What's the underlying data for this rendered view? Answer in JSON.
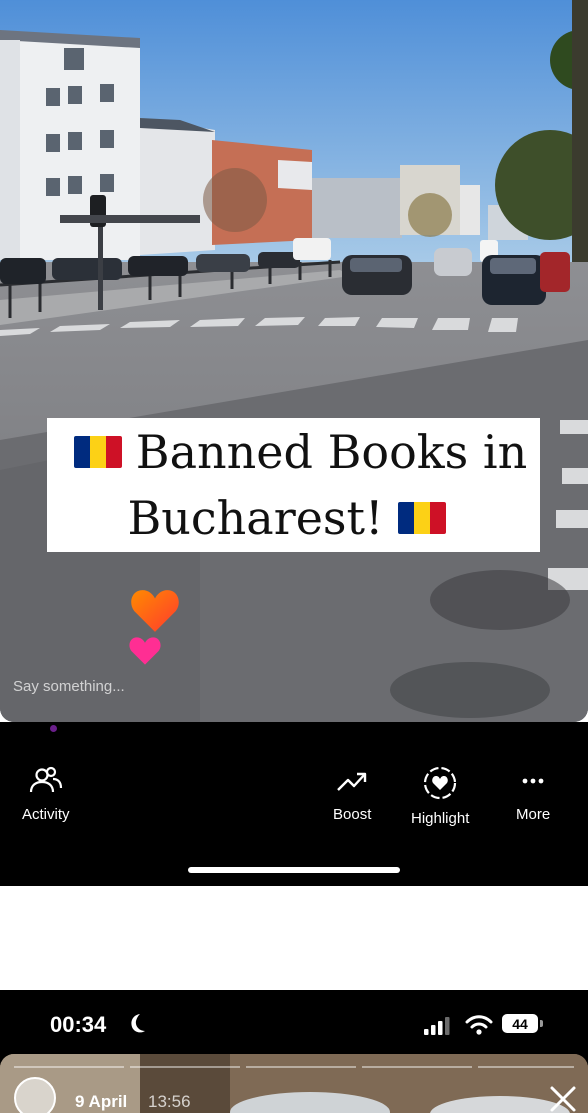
{
  "story": {
    "caption_line1": "Banned Books in",
    "caption_line2": "Bucharest!",
    "comment_placeholder": "Say something..."
  },
  "toolbar": {
    "activity_label": "Activity",
    "boost_label": "Boost",
    "highlight_label": "Highlight",
    "more_label": "More"
  },
  "status_bar": {
    "time": "00:34",
    "battery": "44"
  },
  "story_header": {
    "date": "9 April",
    "time": "13:56"
  },
  "icons": {
    "flag": "romania-flag-icon",
    "activity": "people-icon",
    "boost": "trending-up-icon",
    "highlight": "heart-circle-icon",
    "more": "ellipsis-icon",
    "status": [
      "moon-icon",
      "signal-icon",
      "wifi-icon",
      "battery-icon"
    ],
    "close": "close-icon"
  },
  "colors": {
    "flag_blue": "#002b7f",
    "flag_yellow": "#fcd116",
    "flag_red": "#ce1126",
    "heart_orange": "#ff5a1f",
    "heart_pink": "#ff2e93",
    "toolbar_bg": "#000000"
  }
}
